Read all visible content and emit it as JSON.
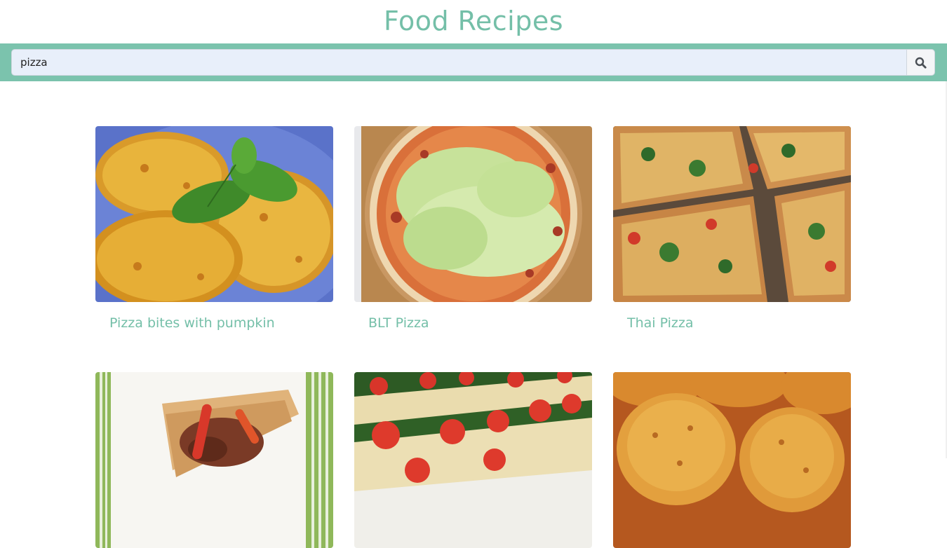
{
  "header": {
    "title": "Food Recipes"
  },
  "search": {
    "value": "pizza",
    "button_icon": "search-icon"
  },
  "colors": {
    "accent": "#74bfa8",
    "bar": "#7bc3ad",
    "input_bg": "#e8effa"
  },
  "recipes": [
    {
      "title": "Pizza bites with pumpkin",
      "image": "pizza-bites-photo"
    },
    {
      "title": "BLT Pizza",
      "image": "blt-pizza-photo"
    },
    {
      "title": "Thai Pizza",
      "image": "thai-pizza-photo"
    },
    {
      "title": "",
      "image": "pizza-slice-photo"
    },
    {
      "title": "",
      "image": "zucchini-pizza-photo"
    },
    {
      "title": "",
      "image": "pizza-muffins-photo"
    }
  ]
}
